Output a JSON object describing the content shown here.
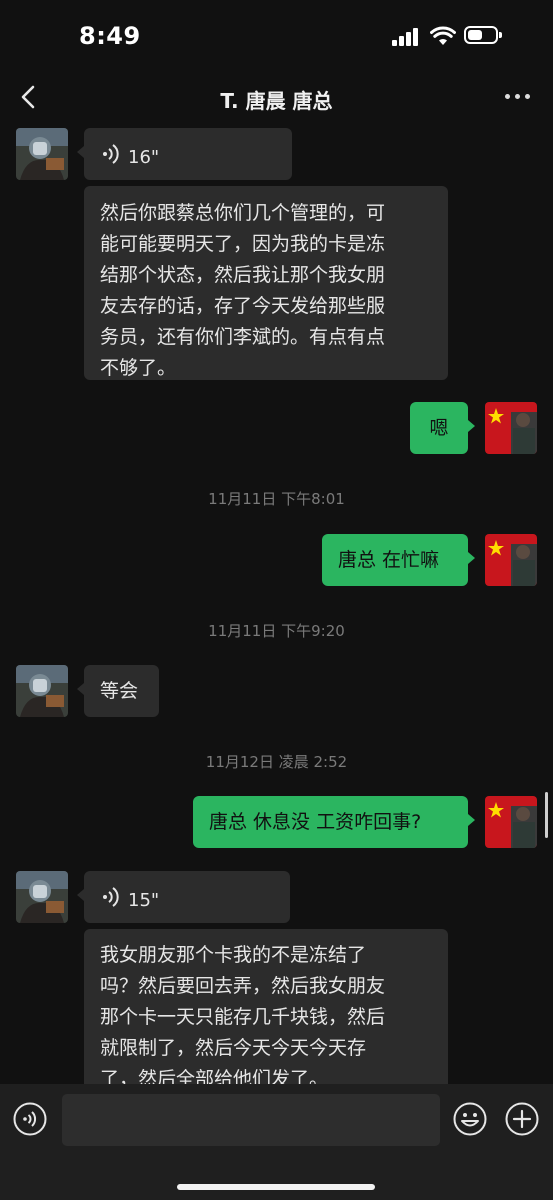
{
  "status_bar": {
    "time": "8:49",
    "battery_level": 0.55
  },
  "header": {
    "title": "T. 唐晨 唐总"
  },
  "icons": {
    "back": "chevron-left-icon",
    "more": "more-dots-icon",
    "voice_input": "voice-input-icon",
    "emoji": "emoji-icon",
    "add": "plus-icon"
  },
  "colors": {
    "background": "#111111",
    "incoming_bubble": "#2c2c2c",
    "outgoing_bubble": "#2bb560"
  },
  "messages": [
    {
      "type": "voice",
      "direction": "in",
      "duration": "16\""
    },
    {
      "type": "text",
      "direction": "in",
      "lines": [
        "然后你跟蔡总你们几个管理的，可",
        "能可能要明天了，因为我的卡是冻",
        "结那个状态，然后我让那个我女朋",
        "友去存的话，存了今天发给那些服",
        "务员，还有你们李斌的。有点有点",
        "不够了。"
      ]
    },
    {
      "type": "text",
      "direction": "out",
      "text": "嗯"
    },
    {
      "type": "timestamp",
      "text": "11月11日 下午8:01"
    },
    {
      "type": "text",
      "direction": "out",
      "text": "唐总 在忙嘛"
    },
    {
      "type": "timestamp",
      "text": "11月11日 下午9:20"
    },
    {
      "type": "text",
      "direction": "in",
      "text": "等会"
    },
    {
      "type": "timestamp",
      "text": "11月12日 凌晨 2:52"
    },
    {
      "type": "text",
      "direction": "out",
      "text": "唐总 休息没 工资咋回事?"
    },
    {
      "type": "voice",
      "direction": "in",
      "duration": "15\""
    },
    {
      "type": "text",
      "direction": "in",
      "lines": [
        "我女朋友那个卡我的不是冻结了",
        "吗？然后要回去弄，然后我女朋友",
        "那个卡一天只能存几千块钱，然后",
        "就限制了，然后今天今天今天存",
        "了，然后全部给他们发了。"
      ]
    }
  ]
}
